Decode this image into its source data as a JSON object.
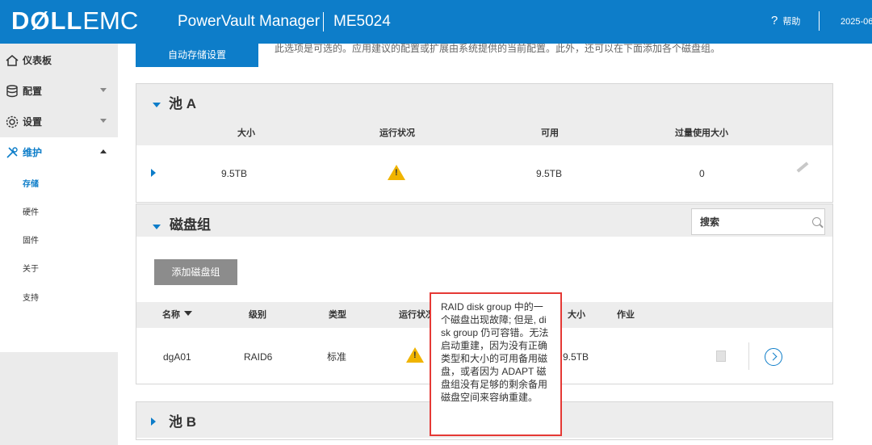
{
  "header": {
    "logo_dell": "DØLL",
    "logo_emc": "EMC",
    "app_title": "PowerVault Manager",
    "model": "ME5024",
    "help_label": "帮助",
    "date": "2025-06"
  },
  "sidebar": {
    "items": [
      {
        "label": "仪表板"
      },
      {
        "label": "配置"
      },
      {
        "label": "设置"
      },
      {
        "label": "维护"
      }
    ],
    "sub_items": [
      {
        "label": "存储"
      },
      {
        "label": "硬件"
      },
      {
        "label": "固件"
      },
      {
        "label": "关于"
      },
      {
        "label": "支持"
      }
    ]
  },
  "main": {
    "auto_button": "自动存储设置",
    "top_note": "此选项是可选的。应用建议的配置或扩展由系统提供的当前配置。此外，还可以在下面添加各个磁盘组。",
    "pool_a": {
      "title": "池 A",
      "columns": [
        "大小",
        "运行状况",
        "可用",
        "过量使用大小"
      ],
      "row": {
        "size": "9.5TB",
        "available": "9.5TB",
        "overcommit": "0"
      }
    },
    "disk_groups": {
      "title": "磁盘组",
      "search_placeholder": "搜索",
      "add_button": "添加磁盘组",
      "columns": [
        "名称",
        "级别",
        "类型",
        "运行状况",
        "大小",
        "作业"
      ],
      "rows": [
        {
          "name": "dgA01",
          "level": "RAID6",
          "type": "标准",
          "size": "9.5TB"
        }
      ]
    },
    "pool_b": {
      "title": "池 B"
    },
    "tooltip": "RAID disk group 中的一个磁盘出现故障; 但是, disk group 仍可容错。无法启动重建，因为没有正确类型和大小的可用备用磁盘，或者因为 ADAPT 磁盘组没有足够的剩余备用磁盘空间来容纳重建。"
  },
  "colors": {
    "accent": "#0d7dc9",
    "warning": "#f0b400",
    "highlight": "#e53935"
  }
}
